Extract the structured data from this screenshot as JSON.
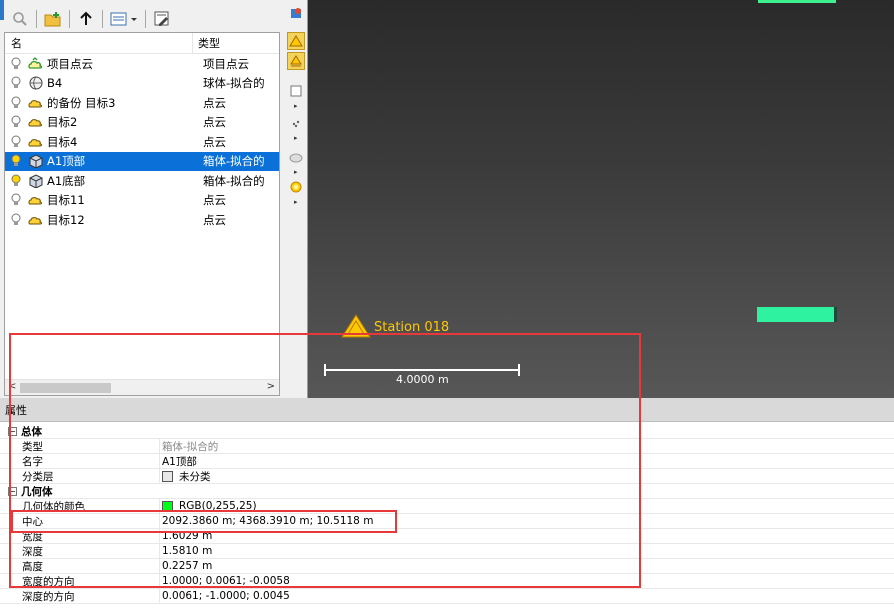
{
  "browser": {
    "columns": {
      "name": "名",
      "type": "类型"
    },
    "items": [
      {
        "name": "项目点云",
        "type": "项目点云",
        "icon": "project-cloud-icon",
        "selected": false
      },
      {
        "name": "B4",
        "type": "球体-拟合的",
        "icon": "sphere-icon",
        "selected": false
      },
      {
        "name": "的备份 目标3",
        "type": "点云",
        "icon": "point-cloud-icon",
        "selected": false
      },
      {
        "name": "目标2",
        "type": "点云",
        "icon": "point-cloud-icon",
        "selected": false
      },
      {
        "name": "目标4",
        "type": "点云",
        "icon": "point-cloud-icon",
        "selected": false
      },
      {
        "name": "A1顶部",
        "type": "箱体-拟合的",
        "icon": "box-icon",
        "selected": true
      },
      {
        "name": "A1底部",
        "type": "箱体-拟合的",
        "icon": "box-icon",
        "selected": false
      },
      {
        "name": "目标11",
        "type": "点云",
        "icon": "point-cloud-icon",
        "selected": false
      },
      {
        "name": "目标12",
        "type": "点云",
        "icon": "point-cloud-icon",
        "selected": false
      }
    ]
  },
  "viewport": {
    "station_label": "Station 018",
    "scale_label": "4.0000 m"
  },
  "properties": {
    "title": "属性",
    "general": {
      "header": "总体",
      "rows": [
        {
          "key": "类型",
          "value": "箱体-拟合的"
        },
        {
          "key": "名字",
          "value": "A1顶部"
        },
        {
          "key": "分类层",
          "value": "未分类"
        }
      ]
    },
    "geometry": {
      "header": "几何体",
      "rows": [
        {
          "key": "几何体的颜色",
          "value": "RGB(0,255,25)"
        },
        {
          "key": "中心",
          "value": "2092.3860 m; 4368.3910 m; 10.5118 m"
        },
        {
          "key": "宽度",
          "value": "1.6029 m"
        },
        {
          "key": "深度",
          "value": "1.5810 m"
        },
        {
          "key": "高度",
          "value": "0.2257 m"
        },
        {
          "key": "宽度的方向",
          "value": "1.0000; 0.0061; -0.0058"
        },
        {
          "key": "深度的方向",
          "value": "0.0061; -1.0000; 0.0045"
        }
      ]
    }
  },
  "colors": {
    "selection": "#0b71d8",
    "geometry_color": "#00ff19",
    "annotation_red": "#e8393a",
    "station_yellow": "#ffc800",
    "target_green": "#2ef2a0"
  }
}
